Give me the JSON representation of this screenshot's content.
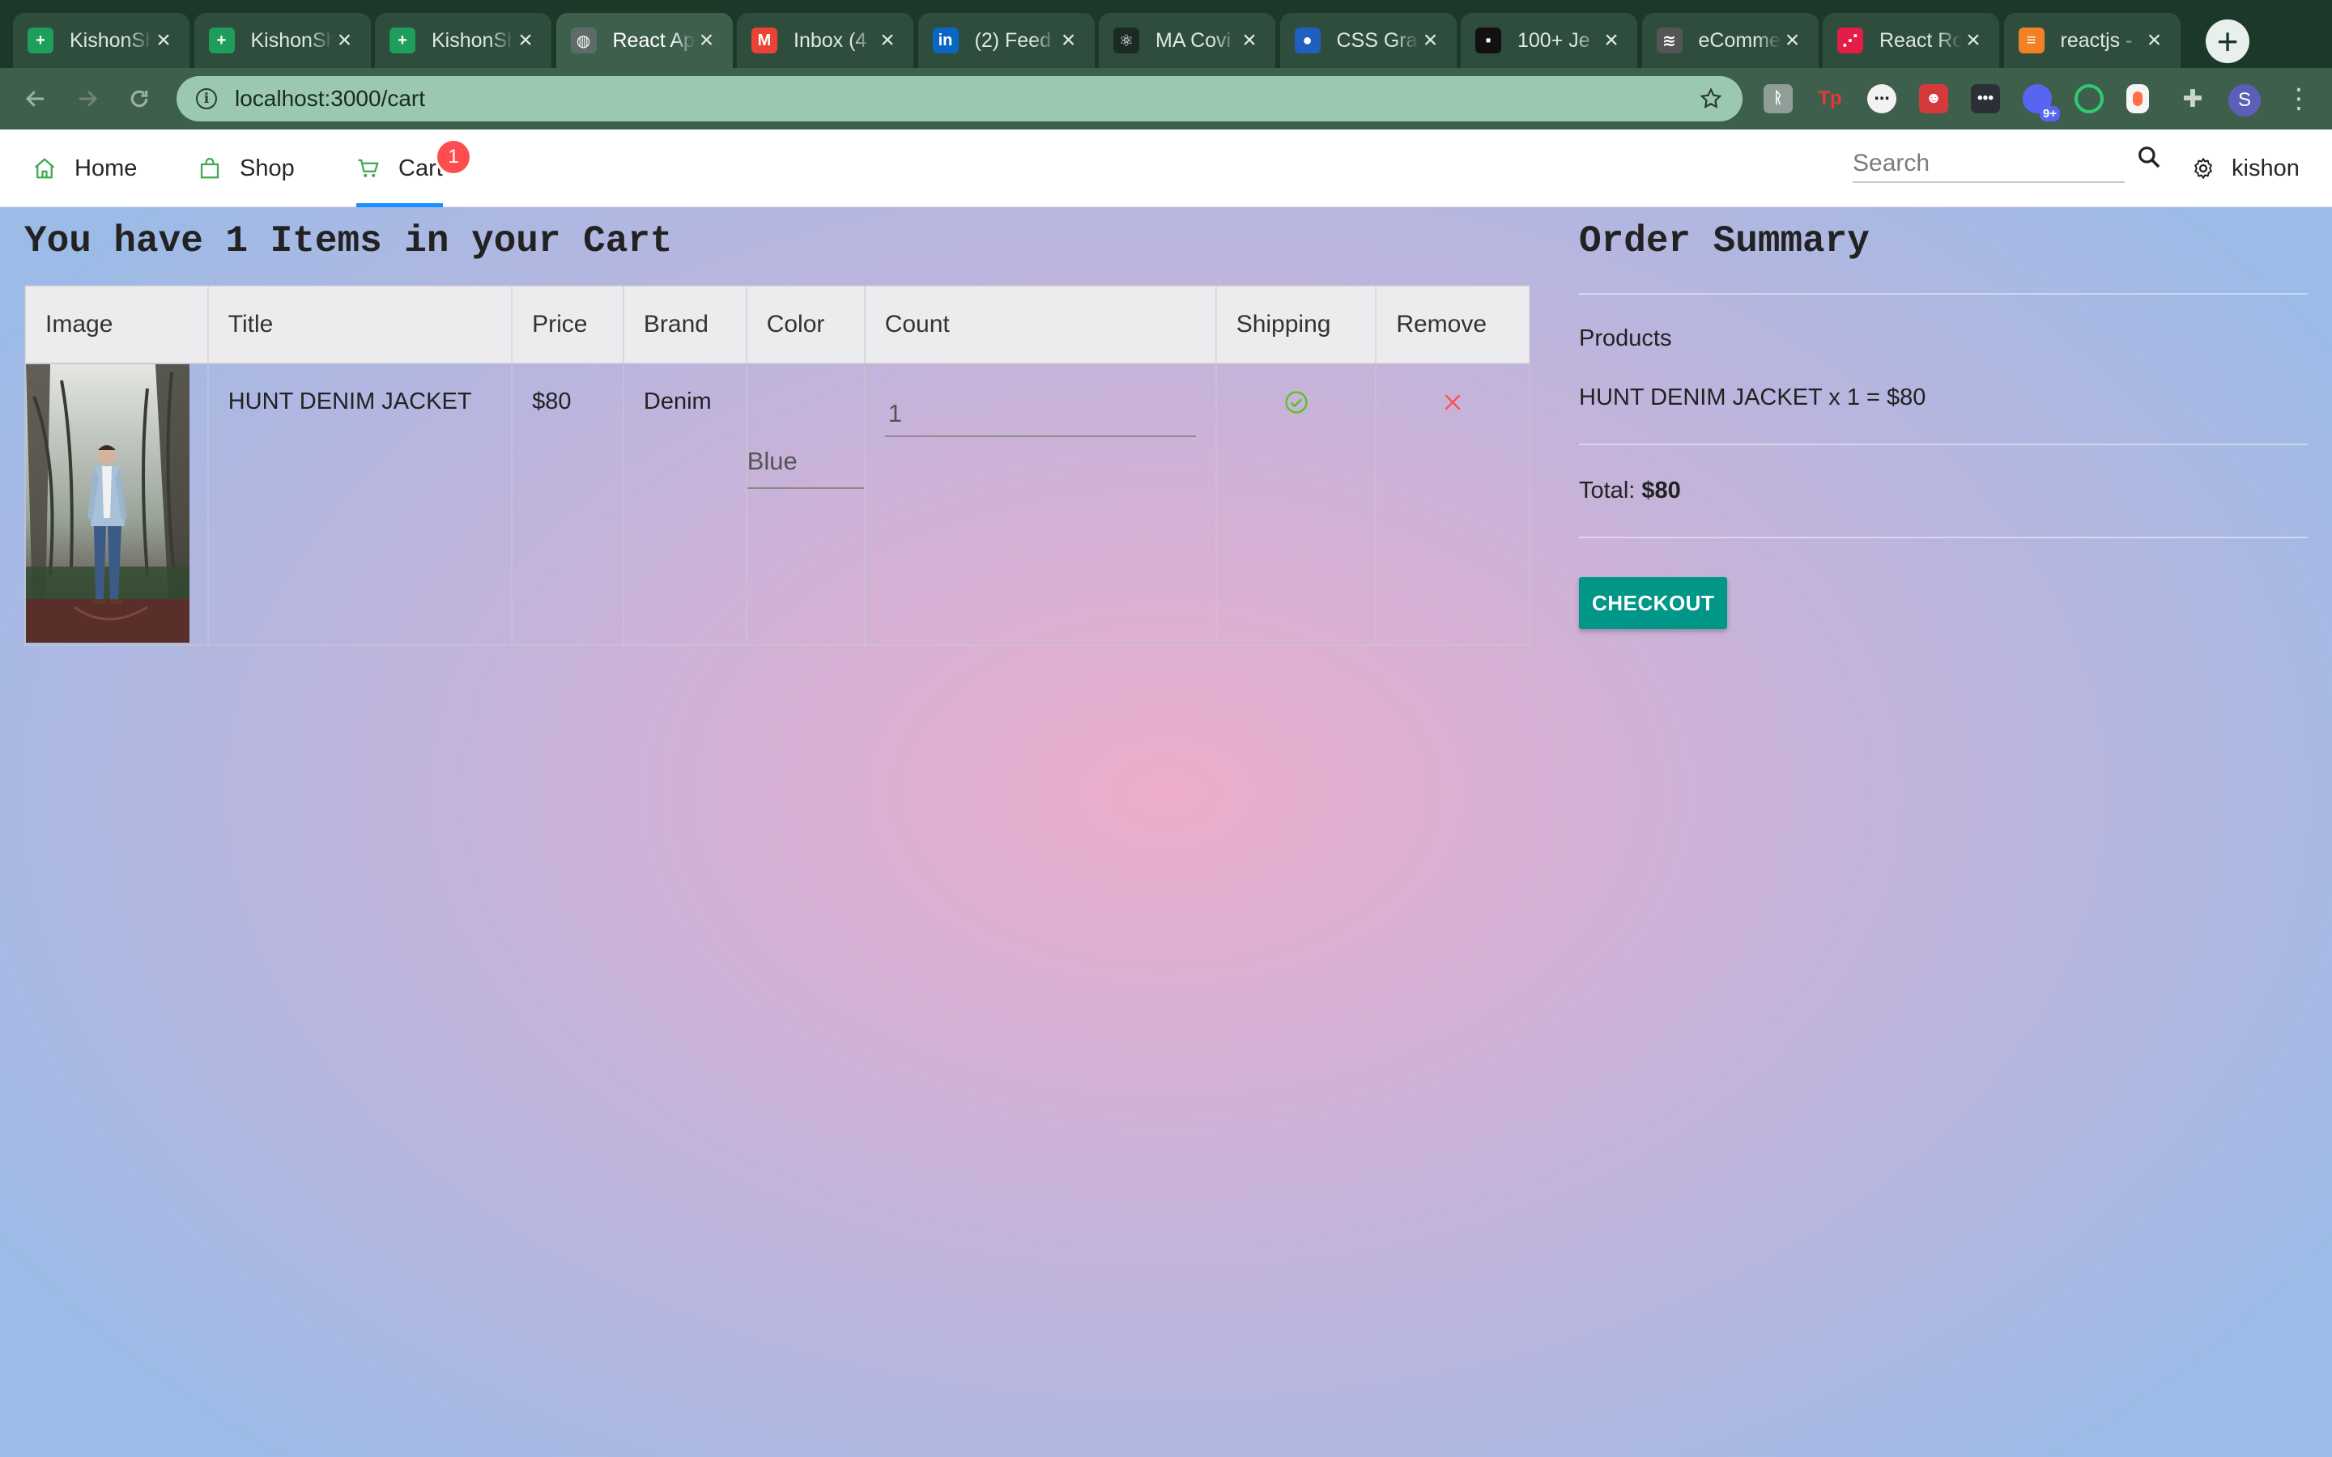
{
  "browser": {
    "tabs": [
      {
        "title": "KishonSh",
        "icon": "google-sheets-icon",
        "color": "#1e9e5a"
      },
      {
        "title": "KishonSh",
        "icon": "google-sheets-icon",
        "color": "#1e9e5a"
      },
      {
        "title": "KishonSh",
        "icon": "google-sheets-icon",
        "color": "#1e9e5a"
      },
      {
        "title": "React App",
        "icon": "globe-icon",
        "color": "#5f6b66",
        "active": true
      },
      {
        "title": "Inbox (4",
        "icon": "gmail-icon",
        "color": "#ea4335"
      },
      {
        "title": "(2) Feed",
        "icon": "linkedin-icon",
        "color": "#0a66c2"
      },
      {
        "title": "MA Covi",
        "icon": "react-icon",
        "color": "#1b2a22"
      },
      {
        "title": "CSS Gra",
        "icon": "css-icon",
        "color": "#1f5fbf"
      },
      {
        "title": "100+ Je",
        "icon": "unsplash-icon",
        "color": "#111111"
      },
      {
        "title": "eComme",
        "icon": "squarespace-icon",
        "color": "#555555"
      },
      {
        "title": "React Ro",
        "icon": "react-router-icon",
        "color": "#e11d48"
      },
      {
        "title": "reactjs -",
        "icon": "stackoverflow-icon",
        "color": "#f48024"
      }
    ],
    "new_tab": "+",
    "url": "localhost:3000/cart",
    "extension_badge": "9+",
    "profile_initial": "S"
  },
  "nav": {
    "home": "Home",
    "shop": "Shop",
    "cart": "Cart",
    "cart_count": "1",
    "search_placeholder": "Search",
    "user": "kishon"
  },
  "cart": {
    "heading": "You have 1 Items in your Cart",
    "columns": [
      "Image",
      "Title",
      "Price",
      "Brand",
      "Color",
      "Count",
      "Shipping",
      "Remove"
    ],
    "items": [
      {
        "title": "HUNT DENIM JACKET",
        "price": "$80",
        "brand": "Denim",
        "color": "Blue",
        "count": "1",
        "shipping": "yes"
      }
    ]
  },
  "summary": {
    "title": "Order Summary",
    "products_label": "Products",
    "line": "HUNT DENIM JACKET x 1 = $80",
    "total_label": "Total:",
    "total_value": "$80",
    "checkout_label": "CHECKOUT"
  },
  "colors": {
    "accent_blue": "#1890ff",
    "badge_red": "#ff4d4f",
    "checkout_teal": "#009688",
    "ship_green": "#52c41a",
    "remove_red": "#ff4d4f"
  }
}
